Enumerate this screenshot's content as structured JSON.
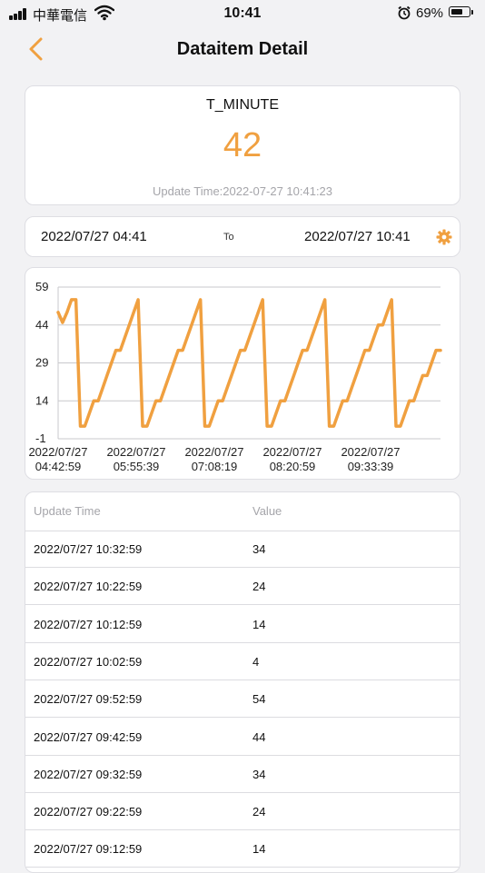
{
  "status_bar": {
    "carrier": "中華電信",
    "time": "10:41",
    "battery_percent": "69%",
    "battery_level": 0.69
  },
  "nav": {
    "title": "Dataitem Detail"
  },
  "item": {
    "name": "T_MINUTE",
    "value": "42",
    "update_time": "Update Time:2022-07-27 10:41:23"
  },
  "range": {
    "from": "2022/07/27 04:41",
    "to_label": "To",
    "to": "2022/07/27 10:41"
  },
  "colors": {
    "accent": "#f0a040",
    "muted_text": "#a5a5aa"
  },
  "chart_data": {
    "type": "line",
    "x_tick_labels": [
      [
        "2022/07/27",
        "04:42:59"
      ],
      [
        "2022/07/27",
        "05:55:39"
      ],
      [
        "2022/07/27",
        "07:08:19"
      ],
      [
        "2022/07/27",
        "08:20:59"
      ],
      [
        "2022/07/27",
        "09:33:39"
      ]
    ],
    "y_ticks": [
      59,
      44,
      29,
      14,
      -1
    ],
    "ylim": [
      -1,
      59
    ],
    "grid": true,
    "series": [
      {
        "values": [
          49,
          45,
          49,
          54,
          54,
          4,
          4,
          9,
          14,
          14,
          19,
          24,
          29,
          34,
          34,
          39,
          44,
          49,
          54,
          4,
          4,
          9,
          14,
          14,
          19,
          24,
          29,
          34,
          34,
          39,
          44,
          49,
          54,
          4,
          4,
          9,
          14,
          14,
          19,
          24,
          29,
          34,
          34,
          39,
          44,
          49,
          54,
          4,
          4,
          9,
          14,
          14,
          19,
          24,
          29,
          34,
          34,
          39,
          44,
          49,
          54,
          4,
          4,
          9,
          14,
          14,
          19,
          24,
          29,
          34,
          34,
          39,
          44,
          44,
          49,
          54,
          4,
          4,
          9,
          14,
          14,
          19,
          24,
          24,
          29,
          34,
          34
        ]
      }
    ]
  },
  "history": {
    "headers": {
      "time": "Update Time",
      "value": "Value"
    },
    "rows": [
      {
        "time": "2022/07/27 10:32:59",
        "value": "34"
      },
      {
        "time": "2022/07/27 10:22:59",
        "value": "24"
      },
      {
        "time": "2022/07/27 10:12:59",
        "value": "14"
      },
      {
        "time": "2022/07/27 10:02:59",
        "value": "4"
      },
      {
        "time": "2022/07/27 09:52:59",
        "value": "54"
      },
      {
        "time": "2022/07/27 09:42:59",
        "value": "44"
      },
      {
        "time": "2022/07/27 09:32:59",
        "value": "34"
      },
      {
        "time": "2022/07/27 09:22:59",
        "value": "24"
      },
      {
        "time": "2022/07/27 09:12:59",
        "value": "14"
      }
    ]
  }
}
